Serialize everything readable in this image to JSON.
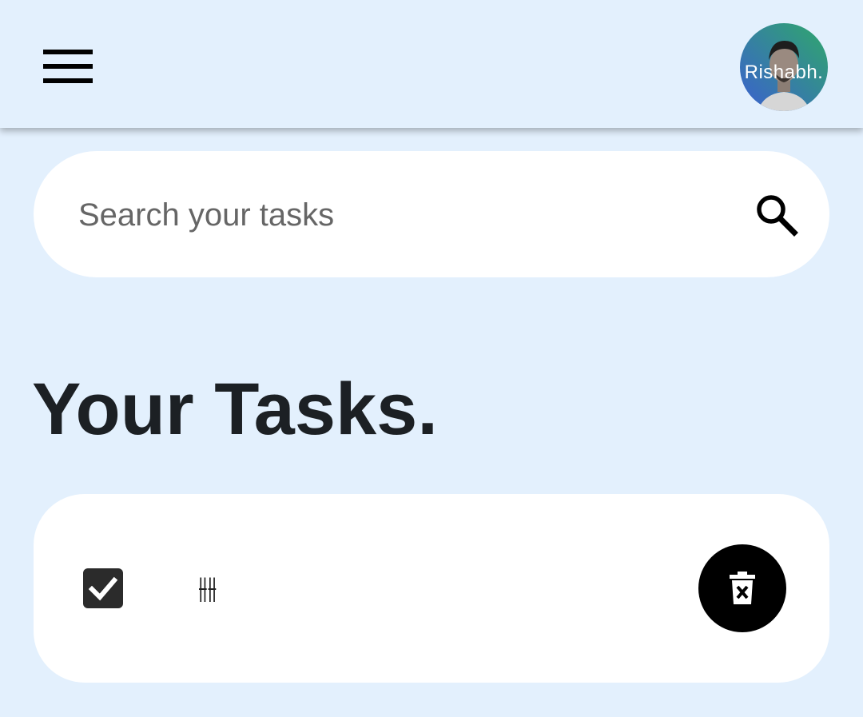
{
  "header": {
    "menu_icon": "hamburger-menu-icon",
    "avatar": {
      "name_text": "Rishabh.",
      "gradient_colors": [
        "#3b5fd1",
        "#2fa86a"
      ]
    }
  },
  "search": {
    "placeholder": "Search your tasks",
    "value": "",
    "icon": "search-icon"
  },
  "main": {
    "title": "Your Tasks.",
    "tasks": [
      {
        "text": "⫲⫲",
        "completed": true,
        "checkbox_icon": "checkbox-checked-icon",
        "delete_icon": "trash-delete-icon"
      }
    ]
  },
  "colors": {
    "background": "#e3f0fd",
    "card": "#ffffff",
    "title": "#1c2024",
    "delete_button": "#000000"
  }
}
